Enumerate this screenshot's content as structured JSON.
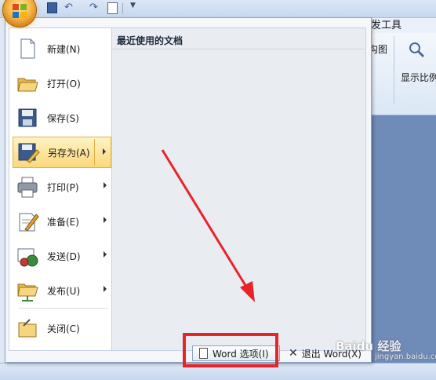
{
  "window": {
    "ribbon_tab_partial": "发工具",
    "ribbon_label_partial": "沟图",
    "zoom_label_partial": "显示比例"
  },
  "menu": {
    "items": [
      {
        "label": "新建(N)",
        "icon": "new-document-icon",
        "has_submenu": false
      },
      {
        "label": "打开(O)",
        "icon": "open-folder-icon",
        "has_submenu": false
      },
      {
        "label": "保存(S)",
        "icon": "save-disk-icon",
        "has_submenu": false
      },
      {
        "label": "另存为(A)",
        "icon": "save-as-icon",
        "has_submenu": true,
        "active": true
      },
      {
        "label": "打印(P)",
        "icon": "printer-icon",
        "has_submenu": true
      },
      {
        "label": "准备(E)",
        "icon": "prepare-icon",
        "has_submenu": true
      },
      {
        "label": "发送(D)",
        "icon": "send-icon",
        "has_submenu": true
      },
      {
        "label": "发布(U)",
        "icon": "publish-icon",
        "has_submenu": true
      },
      {
        "label": "关闭(C)",
        "icon": "close-folder-icon",
        "has_submenu": false
      }
    ],
    "recent_title": "最近使用的文档",
    "options_button": "Word 选项(I)",
    "exit_button": "退出 Word(X)"
  },
  "watermark": {
    "text": "Baidu 经验",
    "sub": "jingyan.baidu.com"
  },
  "colors": {
    "annotation_red": "#e8242a",
    "active_item": "#fbd87a"
  }
}
